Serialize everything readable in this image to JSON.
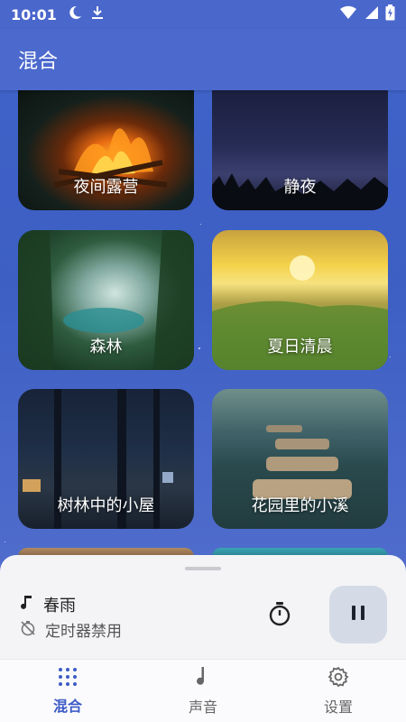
{
  "status_bar": {
    "time": "10:01",
    "icons_left": [
      "moon-icon",
      "download-icon"
    ],
    "icons_right": [
      "wifi-icon",
      "signal-icon",
      "battery-charging-icon"
    ]
  },
  "app_bar": {
    "title": "混合"
  },
  "cards": [
    {
      "label": "夜间露营",
      "theme": "campfire"
    },
    {
      "label": "静夜",
      "theme": "night-sky"
    },
    {
      "label": "森林",
      "theme": "forest"
    },
    {
      "label": "夏日清晨",
      "theme": "summer-morning"
    },
    {
      "label": "树林中的小屋",
      "theme": "cabin"
    },
    {
      "label": "花园里的小溪",
      "theme": "stream"
    }
  ],
  "player": {
    "track_name": "春雨",
    "timer_status": "定时器禁用",
    "icons": [
      "music-note-icon",
      "timer-off-icon",
      "stopwatch-icon",
      "pause-icon"
    ]
  },
  "bottom_nav": {
    "items": [
      {
        "label": "混合",
        "icon": "grid-dots-icon",
        "active": true
      },
      {
        "label": "声音",
        "icon": "music-note-icon",
        "active": false
      },
      {
        "label": "设置",
        "icon": "gear-icon",
        "active": false
      }
    ]
  },
  "colors": {
    "accent": "#3d5bc6",
    "app_bar": "#4c69cd",
    "background": "#3f63c9",
    "sheet": "#f4f4f7"
  }
}
